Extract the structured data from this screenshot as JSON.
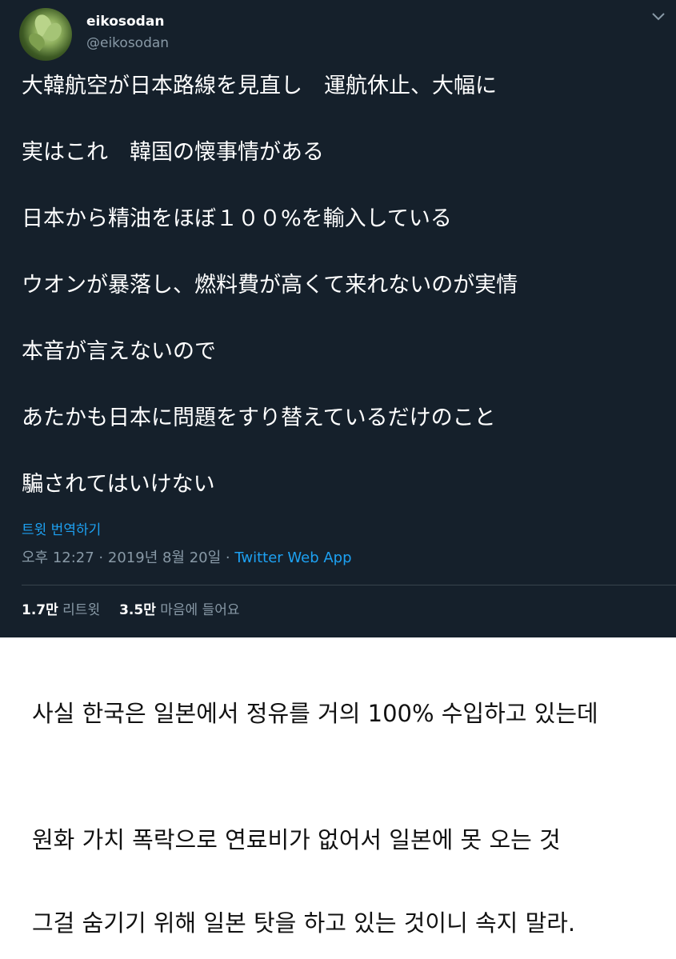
{
  "tweet": {
    "display_name": "eikosodan",
    "handle": "@eikosodan",
    "lines": [
      "大韓航空が日本路線を見直し　運航休止、大幅に",
      "実はこれ　韓国の懐事情がある",
      "日本から精油をほぼ１００%を輸入している",
      "ウオンが暴落し、燃料費が高くて来れないのが実情",
      "本音が言えないので",
      "あたかも日本に問題をすり替えているだけのこと",
      "騙されてはいけない"
    ],
    "translate_label": "트윗 번역하기",
    "timestamp": "오후 12:27 · 2019년 8월 20일 · ",
    "app": "Twitter Web App",
    "retweets_count": "1.7만",
    "retweets_label": "리트윗",
    "likes_count": "3.5만",
    "likes_label": "마음에 들어요",
    "menu_icon": "chevron-down-icon"
  },
  "commentary": {
    "p1": "사실 한국은 일본에서 정유를 거의 100% 수입하고 있는데",
    "p2": "원화 가치 폭락으로 연료비가 없어서 일본에 못 오는 것",
    "p3": "그걸 숨기기 위해 일본 탓을 하고 있는 것이니 속지 말라."
  },
  "colors": {
    "tweet_background": "#15202b",
    "secondary_text": "#8899a6",
    "accent": "#1da1f2",
    "page_background": "#ffffff"
  }
}
